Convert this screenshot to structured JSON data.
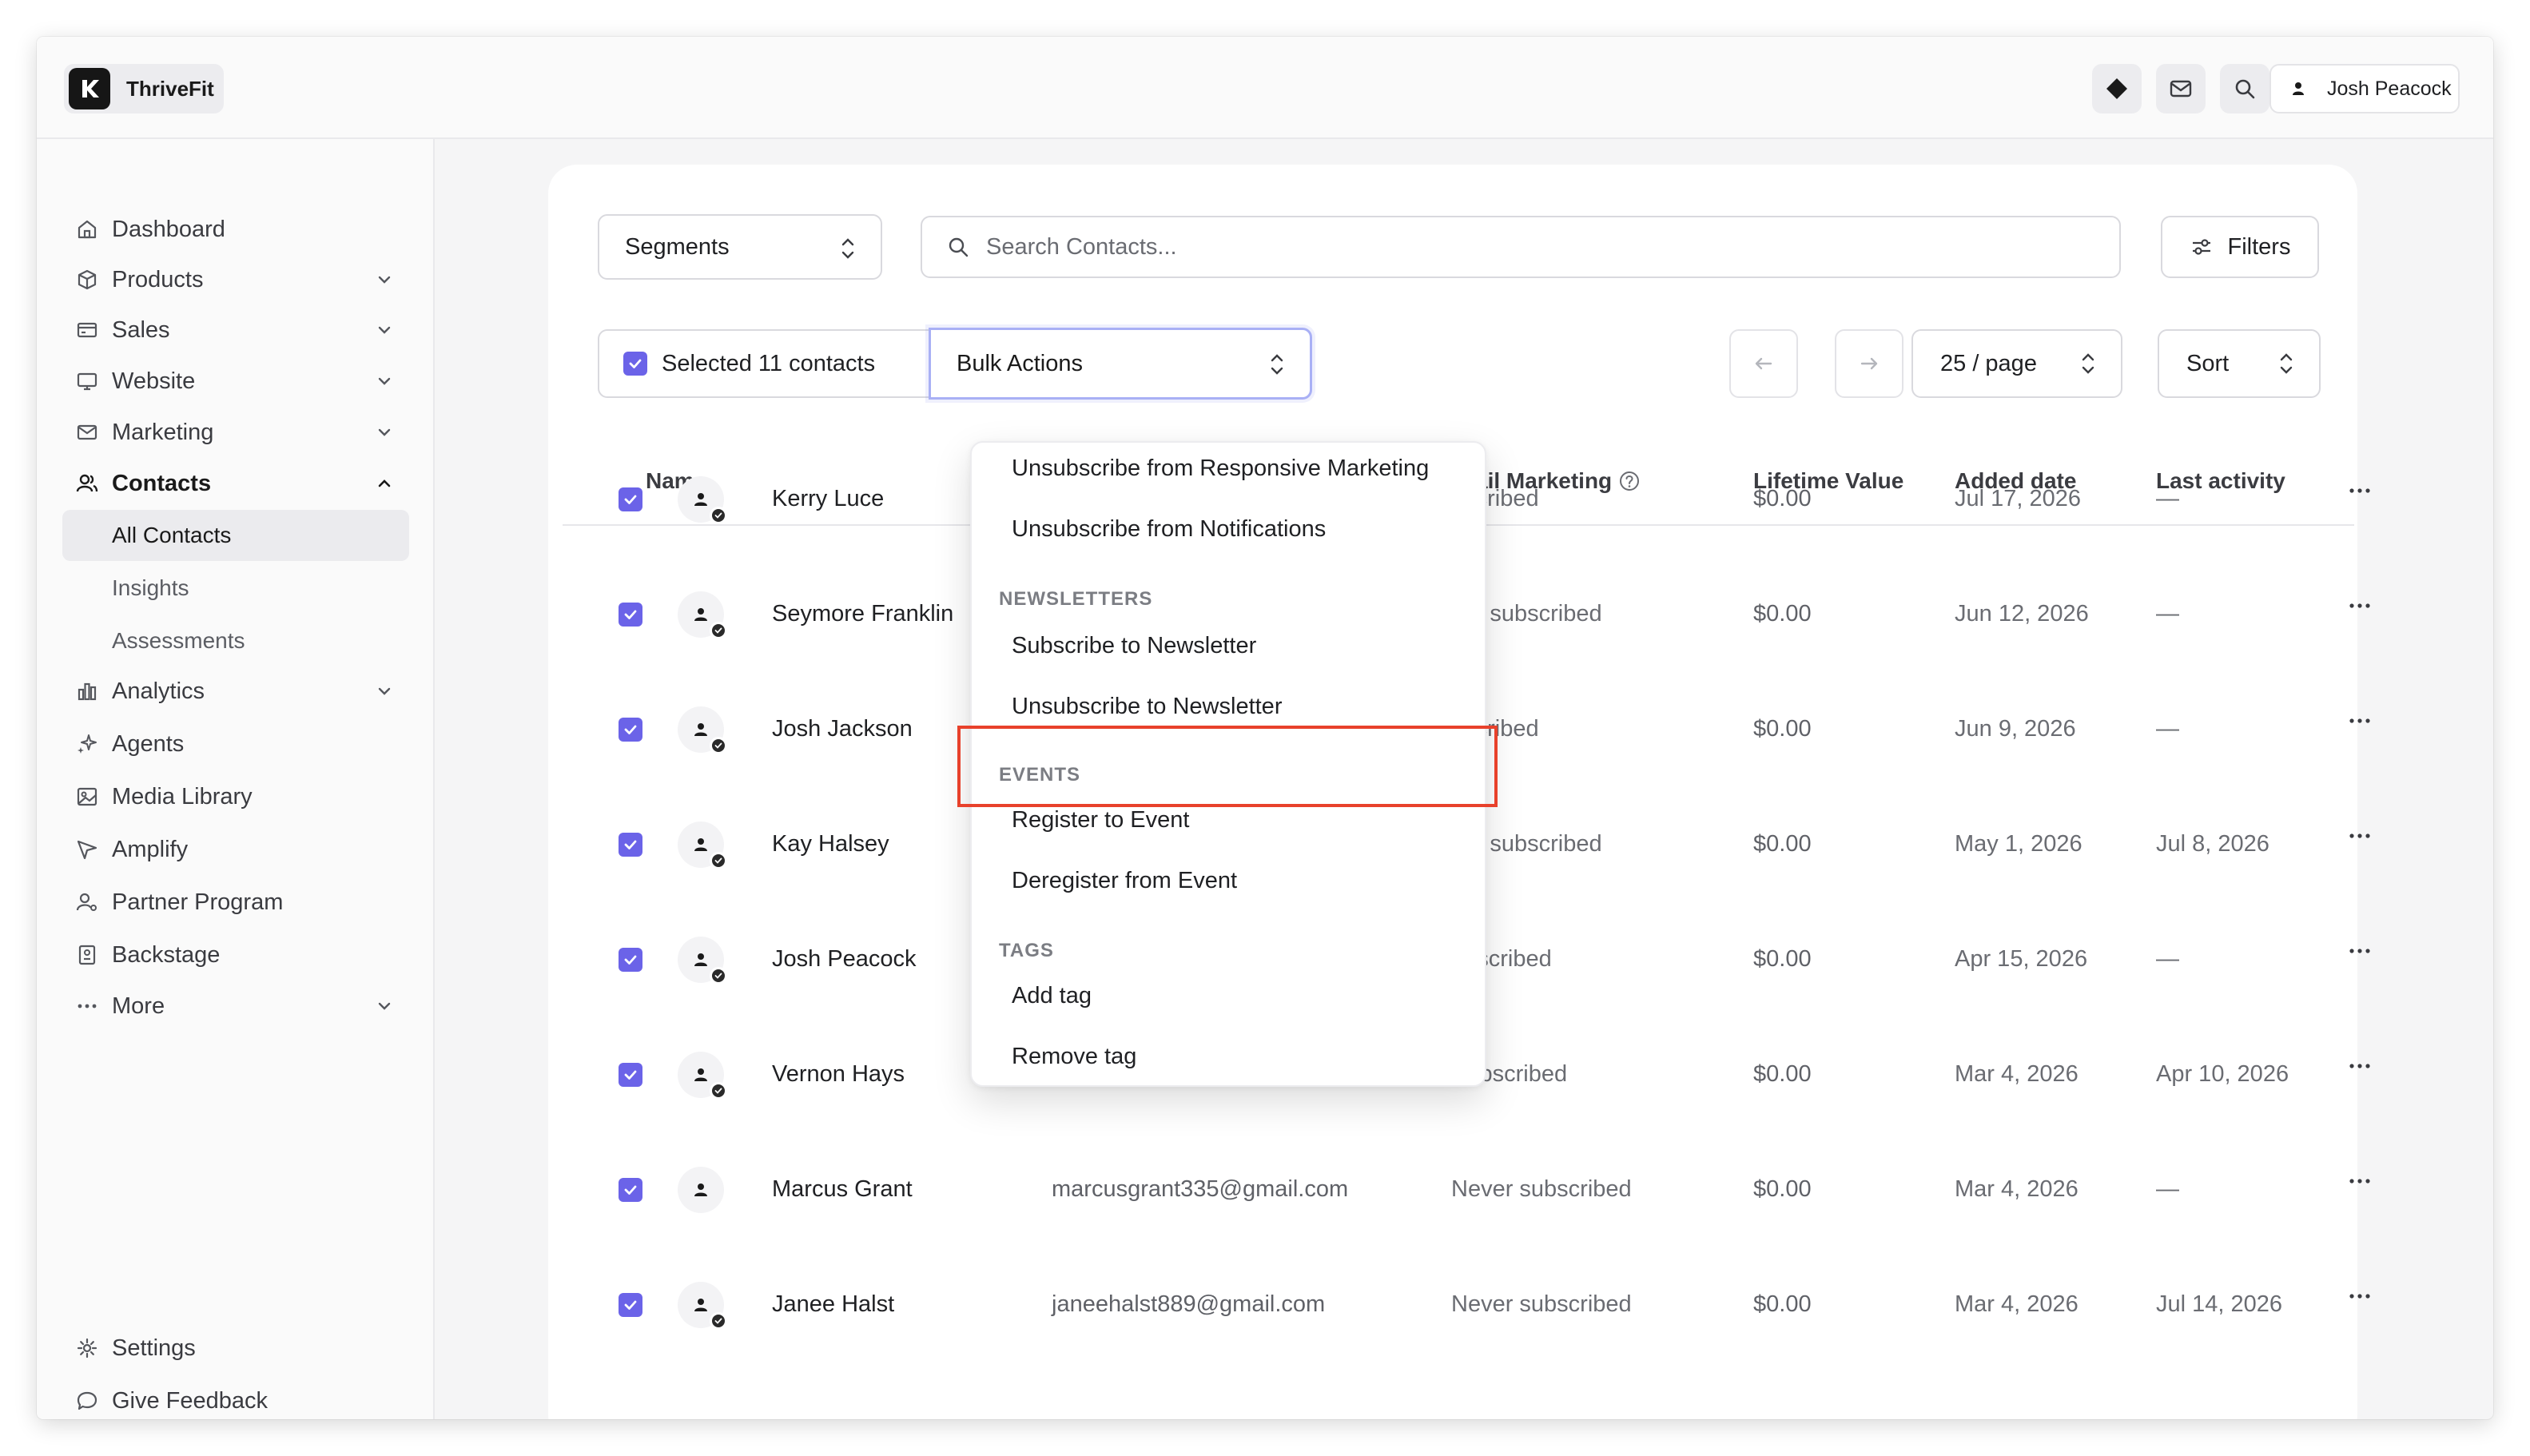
{
  "app": {
    "name": "ThriveFit"
  },
  "user": {
    "name": "Josh Peacock"
  },
  "sidebar": {
    "items": [
      {
        "label": "Dashboard",
        "icon": "home-icon"
      },
      {
        "label": "Products",
        "icon": "box-icon"
      },
      {
        "label": "Sales",
        "icon": "card-icon"
      },
      {
        "label": "Website",
        "icon": "monitor-icon"
      },
      {
        "label": "Marketing",
        "icon": "mail-icon"
      },
      {
        "label": "Contacts",
        "icon": "users-icon"
      },
      {
        "label": "Analytics",
        "icon": "bar-chart-icon"
      },
      {
        "label": "Agents",
        "icon": "sparkle-icon"
      },
      {
        "label": "Media Library",
        "icon": "image-icon"
      },
      {
        "label": "Amplify",
        "icon": "send-icon"
      },
      {
        "label": "Partner Program",
        "icon": "partner-icon"
      },
      {
        "label": "Backstage",
        "icon": "backstage-icon"
      },
      {
        "label": "More",
        "icon": "more-icon"
      }
    ],
    "contacts_sub": [
      "All Contacts",
      "Insights",
      "Assessments"
    ],
    "footer": [
      {
        "label": "Settings",
        "icon": "gear-icon"
      },
      {
        "label": "Give Feedback",
        "icon": "chat-icon"
      }
    ]
  },
  "toolbar": {
    "segments_label": "Segments",
    "search_placeholder": "Search Contacts...",
    "filters_label": "Filters",
    "selected_label": "Selected 11 contacts",
    "bulk_label": "Bulk Actions",
    "per_page": "25 / page",
    "sort_label": "Sort"
  },
  "table": {
    "headers": {
      "name": "Name",
      "email_marketing": "ail Marketing",
      "lifetime_value": "Lifetime Value",
      "added_date": "Added date",
      "last_activity": "Last activity"
    },
    "rows": [
      {
        "name": "Kerry Luce",
        "email": "",
        "status": "bscribed",
        "ltv": "$0.00",
        "added": "Jul 17, 2026",
        "last": "—"
      },
      {
        "name": "Seymore Franklin",
        "email": "",
        "status": "ver subscribed",
        "ltv": "$0.00",
        "added": "Jun 12, 2026",
        "last": "—"
      },
      {
        "name": "Josh Jackson",
        "email": "",
        "status": "bscribed",
        "ltv": "$0.00",
        "added": "Jun 9, 2026",
        "last": "—"
      },
      {
        "name": "Kay Halsey",
        "email": "",
        "status": "ver subscribed",
        "ltv": "$0.00",
        "added": "May 1, 2026",
        "last": "Jul 8, 2026"
      },
      {
        "name": "Josh Peacock",
        "email": "",
        "status": "ubscribed",
        "ltv": "$0.00",
        "added": "Apr 15, 2026",
        "last": "—"
      },
      {
        "name": "Vernon Hays",
        "email": "vernonhays772@gmail.com",
        "status": "Subscribed",
        "ltv": "$0.00",
        "added": "Mar 4, 2026",
        "last": "Apr 10, 2026"
      },
      {
        "name": "Marcus Grant",
        "email": "marcusgrant335@gmail.com",
        "status": "Never subscribed",
        "ltv": "$0.00",
        "added": "Mar 4, 2026",
        "last": "—"
      },
      {
        "name": "Janee Halst",
        "email": "janeehalst889@gmail.com",
        "status": "Never subscribed",
        "ltv": "$0.00",
        "added": "Mar 4, 2026",
        "last": "Jul 14, 2026"
      }
    ]
  },
  "bulk_menu": {
    "items_top": [
      "Unsubscribe from Responsive Marketing",
      "Unsubscribe from Notifications"
    ],
    "newsletters_header": "NEWSLETTERS",
    "newsletters": [
      "Subscribe to Newsletter",
      "Unsubscribe to Newsletter"
    ],
    "events_header": "EVENTS",
    "events": [
      "Register to Event",
      "Deregister from Event"
    ],
    "tags_header": "TAGS",
    "tags": [
      "Add tag",
      "Remove tag"
    ]
  },
  "colors": {
    "accent": "#6b63e8",
    "highlight": "#e8412b",
    "focus_border": "#a9b0f5"
  }
}
